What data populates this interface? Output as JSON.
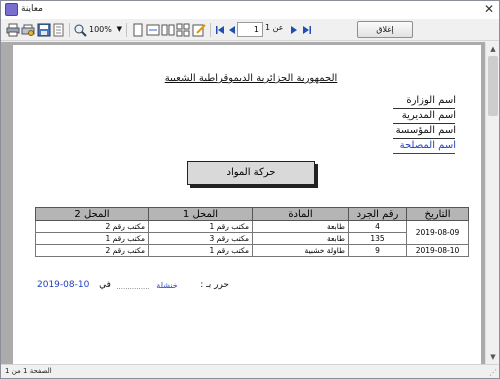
{
  "window": {
    "title": "معاينة",
    "close_glyph": "✕"
  },
  "toolbar": {
    "zoom": "100%",
    "page_input": "1",
    "page_of": "عن 1",
    "close_report_label": "إغلاق",
    "icons": [
      "printer-icon",
      "printer-settings-icon",
      "save-icon",
      "open-icon",
      "binoculars-icon",
      "zoom-in-icon",
      "page-width-icon",
      "one-page-icon",
      "two-pages-icon",
      "multi-page-icon",
      "edit-icon",
      "first-page-icon",
      "prev-page-icon",
      "next-page-icon",
      "last-page-icon"
    ]
  },
  "report": {
    "republic_title": "الجمهورية الجزائرية الديموقراطية الشعبية",
    "header_lines": [
      "اسم الوزارة",
      "اسم المديرية",
      "اسم المؤسسة",
      "اسم المصلحة"
    ],
    "section_title": "حركة المواد",
    "columns": [
      "التاريخ",
      "رقم الجرد",
      "المادة",
      "المحل 1",
      "المحل 2"
    ],
    "groups": [
      {
        "date": "2019-08-09",
        "rows": [
          {
            "inv": "4",
            "item": "طابعة",
            "loc1": "مكتب رقم 1",
            "loc2": "مكتب رقم 2"
          },
          {
            "inv": "135",
            "item": "طابعة",
            "loc1": "مكتب رقم 3",
            "loc2": "مكتب رقم 1"
          }
        ]
      },
      {
        "date": "2019-08-10",
        "rows": [
          {
            "inv": "9",
            "item": "طاولة خشبية",
            "loc1": "مكتب رقم 1",
            "loc2": "مكتب رقم 2"
          }
        ]
      }
    ],
    "signature": {
      "prefix": "حرر بـ :",
      "place": "خنشلة",
      "dots": "...............",
      "on": "في",
      "date": "2019-08-10"
    }
  },
  "status": {
    "text": "الصفحة 1 من 1"
  },
  "colors": {
    "accent_blue": "#1e3fbf",
    "header_gray": "#b5b5b5",
    "viewer_bg": "#ababab"
  }
}
